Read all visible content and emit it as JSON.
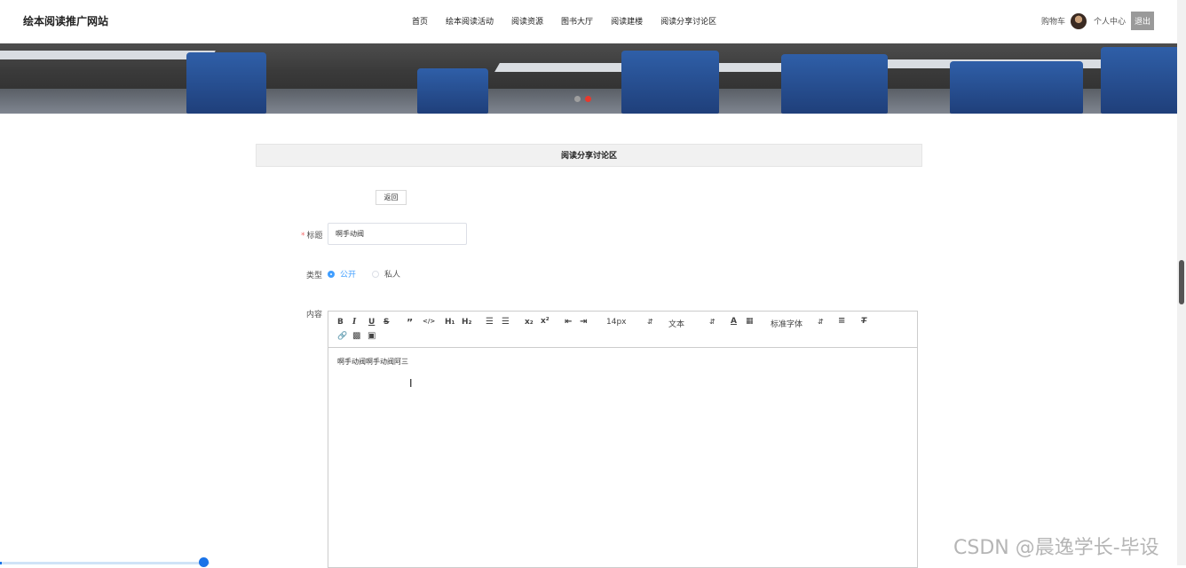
{
  "header": {
    "site_title": "绘本阅读推广网站",
    "nav": [
      "首页",
      "绘本阅读活动",
      "阅读资源",
      "图书大厅",
      "阅读建楼",
      "阅读分享讨论区"
    ],
    "cart": "购物车",
    "profile": "个人中心",
    "logout": "退出"
  },
  "banner": {
    "slides": 2,
    "active_slide": 2,
    "dot_colors": [
      "#9e9e9e",
      "#e8392d"
    ]
  },
  "section": {
    "title": "阅读分享讨论区",
    "back": "返回"
  },
  "form": {
    "title_label": "标题",
    "title_required": "*",
    "title_value": "啊手动阀",
    "type_label": "类型",
    "type_options": [
      "公开",
      "私人"
    ],
    "type_selected": "公开",
    "content_label": "内容"
  },
  "editor": {
    "toolbar": {
      "font_size": "14px",
      "header_select": "文本",
      "font_family": "标准字体",
      "icons": [
        "bold-icon",
        "italic-icon",
        "underline-icon",
        "strike-icon",
        "blockquote-icon",
        "code-block-icon",
        "h1-icon",
        "h2-icon",
        "ordered-list-icon",
        "bullet-list-icon",
        "subscript-icon",
        "superscript-icon",
        "indent-decrease-icon",
        "indent-increase-icon",
        "font-color-icon",
        "background-color-icon",
        "align-icon",
        "clean-format-icon",
        "link-icon",
        "image-icon",
        "video-icon"
      ]
    },
    "content": "啊手动阀啊手动阀阿三"
  },
  "watermark": "CSDN @晨逸学长-毕设",
  "progress": 0.17,
  "colors": {
    "accent": "#409eff",
    "required": "#f56c6c",
    "logout_bg": "#9a9a9a"
  }
}
